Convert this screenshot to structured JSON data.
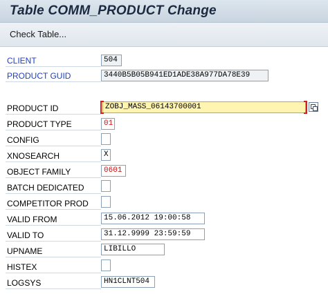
{
  "window": {
    "title": "Table COMM_PRODUCT Change"
  },
  "toolbar": {
    "check_table_label": "Check Table..."
  },
  "fields": {
    "client": {
      "label": "CLIENT",
      "value": "504"
    },
    "product_guid": {
      "label": "PRODUCT GUID",
      "value": "3440B5B05B941ED1ADE38A977DA78E39"
    },
    "product_id": {
      "label": "PRODUCT ID",
      "value": "ZOBJ_MASS_06143700001"
    },
    "product_type": {
      "label": "PRODUCT TYPE",
      "value": "01"
    },
    "config": {
      "label": "CONFIG",
      "value": ""
    },
    "xnosearch": {
      "label": "XNOSEARCH",
      "value": "X"
    },
    "object_family": {
      "label": "OBJECT FAMILY",
      "value": "0601"
    },
    "batch_dedicated": {
      "label": "BATCH DEDICATED",
      "value": ""
    },
    "competitor_prod": {
      "label": "COMPETITOR PROD",
      "value": ""
    },
    "valid_from": {
      "label": "VALID FROM",
      "value": "15.06.2012 19:00:58"
    },
    "valid_to": {
      "label": "VALID TO",
      "value": "31.12.9999 23:59:59"
    },
    "upname": {
      "label": "UPNAME",
      "value": "LIBILLO"
    },
    "histex": {
      "label": "HISTEX",
      "value": ""
    },
    "logsys": {
      "label": "LOGSYS",
      "value": "HN1CLNT504"
    }
  },
  "icons": {
    "value_help": "value-help-icon"
  },
  "colors": {
    "key_label": "#1f3fc4",
    "red_value": "#cc1010",
    "required_bracket": "#d02020",
    "focused_field": "#fff5b1"
  }
}
